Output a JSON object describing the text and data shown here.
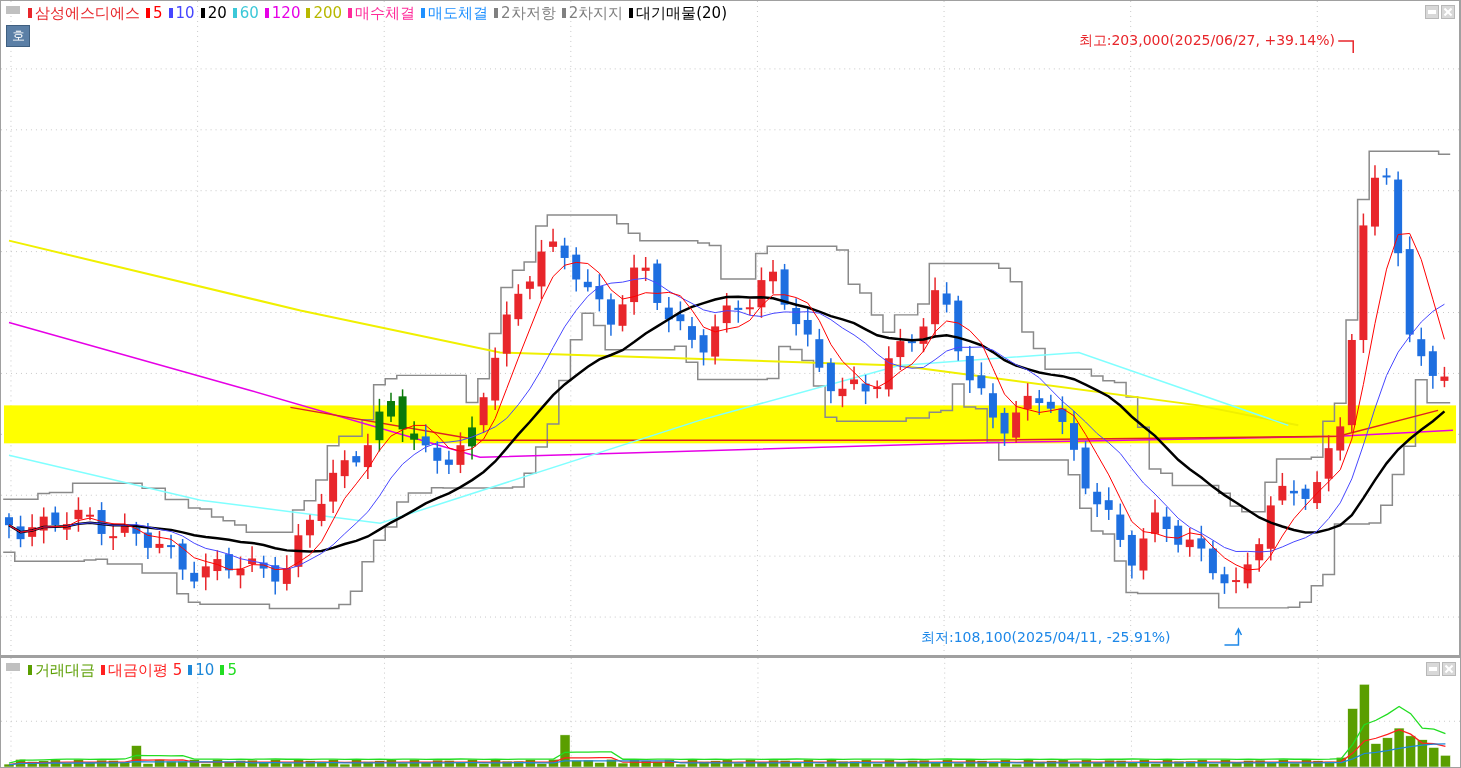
{
  "price_panel": {
    "legend": [
      {
        "label": "삼성에스디에스",
        "color": "#e8262b"
      },
      {
        "label": "5",
        "color": "#ff0000"
      },
      {
        "label": "10",
        "color": "#4646ff"
      },
      {
        "label": "20",
        "color": "#000000"
      },
      {
        "label": "60",
        "color": "#3cc8d8"
      },
      {
        "label": "120",
        "color": "#e600e6"
      },
      {
        "label": "200",
        "color": "#b8b800"
      },
      {
        "label": "매수체결",
        "color": "#ff2a9a"
      },
      {
        "label": "매도체결",
        "color": "#1e90ff"
      },
      {
        "label": "2차저항",
        "color": "#808080"
      },
      {
        "label": "2차지지",
        "color": "#808080"
      },
      {
        "label": "대기매물(20)",
        "color": "#000000"
      }
    ],
    "mode_button": "호",
    "high_label": "최고:203,000(2025/06/27, +39.14%)",
    "low_label": "최저:108,100(2025/04/11, -25.91%)"
  },
  "volume_panel": {
    "legend": [
      {
        "label": "거래대금",
        "color": "#5a9e00"
      },
      {
        "label": "대금이평 5",
        "color": "#ff2020"
      },
      {
        "label": "10",
        "color": "#1e88d8"
      },
      {
        "label": "5",
        "color": "#22dd22"
      }
    ]
  }
}
